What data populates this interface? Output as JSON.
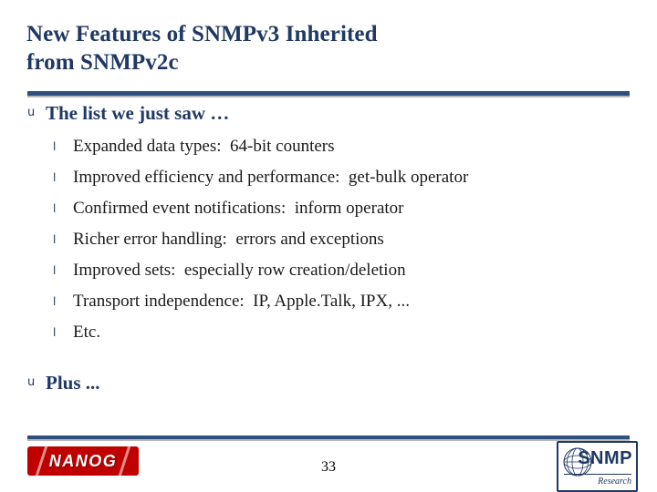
{
  "slide": {
    "title_lines": [
      "New Features of SNMPv3 Inherited",
      "from SNMPv2c"
    ],
    "level1_items": [
      {
        "bullet": "u",
        "label": "The list we just saw …"
      },
      {
        "bullet": "u",
        "label": "Plus ..."
      }
    ],
    "level2_items": [
      {
        "bullet": "l",
        "label": "Expanded data types:  64-bit counters"
      },
      {
        "bullet": "l",
        "label": "Improved efficiency and performance:  get-bulk operator"
      },
      {
        "bullet": "l",
        "label": "Confirmed event notifications:  inform operator"
      },
      {
        "bullet": "l",
        "label": "Richer error handling:  errors and exceptions"
      },
      {
        "bullet": "l",
        "label": "Improved sets:  especially row creation/deletion"
      },
      {
        "bullet": "l",
        "label": "Transport independence:  IP, Apple.Talk, IPX, ..."
      },
      {
        "bullet": "l",
        "label": "Etc."
      }
    ],
    "footer": {
      "page_number": "33",
      "nanog_logo_text": "NANOG",
      "snmp_logo_text": "SNMP",
      "snmp_logo_subtext": "Research"
    },
    "colors": {
      "title_blue": "#1f3864",
      "rule_blue": "#2f4f7f",
      "nanog_red": "#c00000",
      "body_text": "#1a1a1a"
    }
  }
}
